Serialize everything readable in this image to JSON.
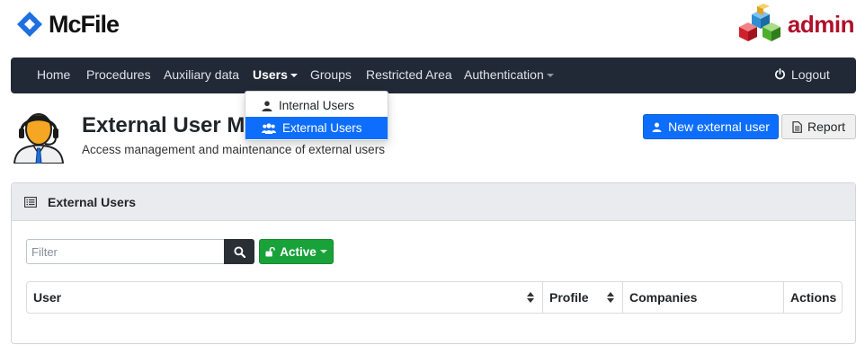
{
  "brand": {
    "name": "McFile"
  },
  "admin_logo": {
    "text": "admin"
  },
  "nav": {
    "items": [
      "Home",
      "Procedures",
      "Auxiliary data",
      "Users",
      "Groups",
      "Restricted Area",
      "Authentication"
    ],
    "logout": "Logout",
    "open_item": "Users"
  },
  "dropdown": {
    "items": [
      "Internal Users",
      "External Users"
    ],
    "selected": "External Users"
  },
  "page": {
    "title": "External User M",
    "subtitle": "Access management and maintenance of external users"
  },
  "actions": {
    "new_user": "New external user",
    "report": "Report"
  },
  "panel": {
    "title": "External Users",
    "filter_placeholder": "Filter",
    "status_filter": "Active",
    "columns": [
      "User",
      "Profile",
      "Companies",
      "Actions"
    ]
  },
  "colors": {
    "navbar": "#212936",
    "primary": "#0d6efd",
    "success": "#1aa23a",
    "admin_red": "#b0102a"
  },
  "icons": {
    "brand": "mcfile-logo-icon",
    "admin": "admin-cubes-icon",
    "logout": "power-icon",
    "internal_users": "user-icon",
    "external_users": "users-icon",
    "new_user": "user-icon",
    "report": "file-text-icon",
    "panel": "list-icon",
    "search": "search-icon",
    "status": "unlock-icon",
    "sort": "sort-icon"
  }
}
